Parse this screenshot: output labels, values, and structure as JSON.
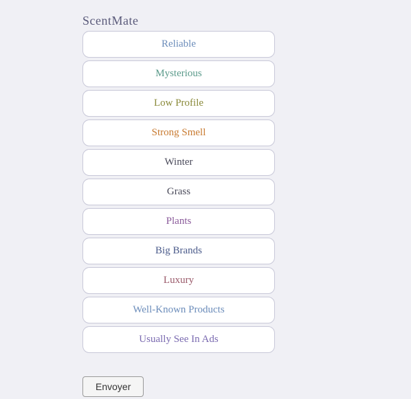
{
  "app": {
    "title": "ScentMate"
  },
  "items": [
    {
      "id": "reliable",
      "label": "Reliable",
      "color": "color-blue"
    },
    {
      "id": "mysterious",
      "label": "Mysterious",
      "color": "color-teal"
    },
    {
      "id": "low-profile",
      "label": "Low Profile",
      "color": "color-olive"
    },
    {
      "id": "strong-smell",
      "label": "Strong Smell",
      "color": "color-orange"
    },
    {
      "id": "winter",
      "label": "Winter",
      "color": "color-dark"
    },
    {
      "id": "grass",
      "label": "Grass",
      "color": "color-dark"
    },
    {
      "id": "plants",
      "label": "Plants",
      "color": "color-purple"
    },
    {
      "id": "big-brands",
      "label": "Big Brands",
      "color": "color-navy"
    },
    {
      "id": "luxury",
      "label": "Luxury",
      "color": "color-rose"
    },
    {
      "id": "well-known-products",
      "label": "Well-Known Products",
      "color": "color-blue"
    },
    {
      "id": "usually-see-in-ads",
      "label": "Usually See In Ads",
      "color": "color-multiA"
    }
  ],
  "submit": {
    "label": "Envoyer"
  }
}
